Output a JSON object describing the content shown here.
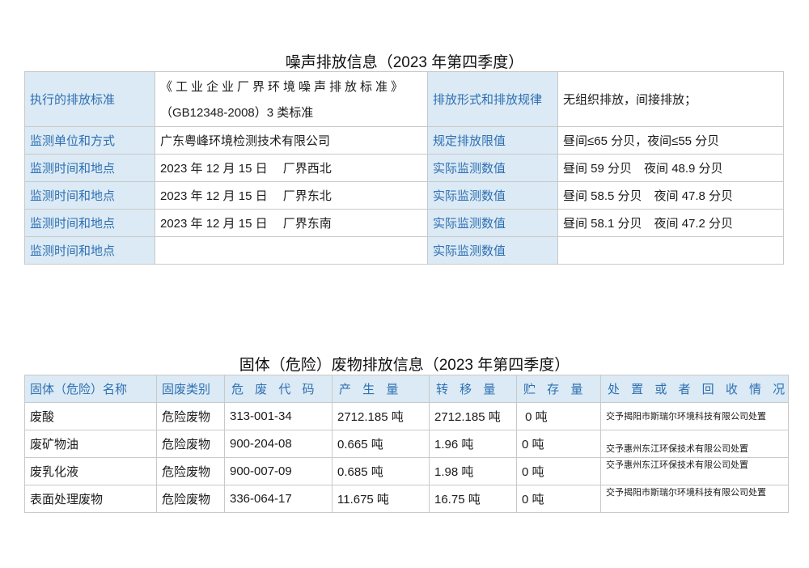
{
  "noise": {
    "title": "噪声排放信息（2023 年第四季度）",
    "labels": {
      "standard": "执行的排放标准",
      "form": "排放形式和排放规律",
      "monitor_unit": "监测单位和方式",
      "limit": "规定排放限值",
      "time_place": "监测时间和地点",
      "actual": "实际监测数值"
    },
    "standard_line1": "《工业企业厂界环境噪声排放标准》",
    "standard_line2": "（GB12348-2008）3 类标准",
    "form_value": "无组织排放，间接排放；",
    "monitor_unit_value": "广东粤峰环境检测技术有限公司",
    "limit_value": "昼间≤65 分贝，夜间≤55 分贝",
    "rows": [
      {
        "time_place": "2023 年 12 月 15 日　 厂界西北",
        "actual": "昼间 59 分贝　夜间 48.9 分贝"
      },
      {
        "time_place": "2023 年 12 月 15 日　 厂界东北",
        "actual": "昼间 58.5 分贝　夜间 47.8 分贝"
      },
      {
        "time_place": "2023 年 12 月 15 日　 厂界东南",
        "actual": "昼间 58.1 分贝　夜间 47.2 分贝"
      },
      {
        "time_place": "",
        "actual": ""
      }
    ]
  },
  "waste": {
    "title": "固体（危险）废物排放信息（2023 年第四季度）",
    "headers": [
      "固体（危险）名称",
      "固废类别",
      "危 废 代 码",
      "产 生 量",
      "转 移 量",
      "贮 存 量",
      "处 置 或 者 回 收 情 况"
    ],
    "rows": [
      {
        "name": "废酸",
        "category": "危险废物",
        "code": "313-001-34",
        "produced": "2712.185 吨",
        "transferred": "2712.185 吨",
        "stored": " 0 吨",
        "disposal": "交予揭阳市斯瑞尔环境科技有限公司处置"
      },
      {
        "name": "废矿物油",
        "category": "危险废物",
        "code": "900-204-08",
        "produced": "0.665 吨",
        "transferred": "1.96 吨",
        "stored": "0 吨",
        "disposal": "交予惠州东江环保技术有限公司处置"
      },
      {
        "name": "废乳化液",
        "category": "危险废物",
        "code": "900-007-09",
        "produced": "0.685 吨",
        "transferred": "1.98 吨",
        "stored": "0 吨",
        "disposal": "交予惠州东江环保技术有限公司处置"
      },
      {
        "name": "表面处理废物",
        "category": "危险废物",
        "code": "336-064-17",
        "produced": "11.675 吨",
        "transferred": "16.75 吨",
        "stored": "0 吨",
        "disposal": "交予揭阳市斯瑞尔环境科技有限公司处置"
      }
    ]
  }
}
